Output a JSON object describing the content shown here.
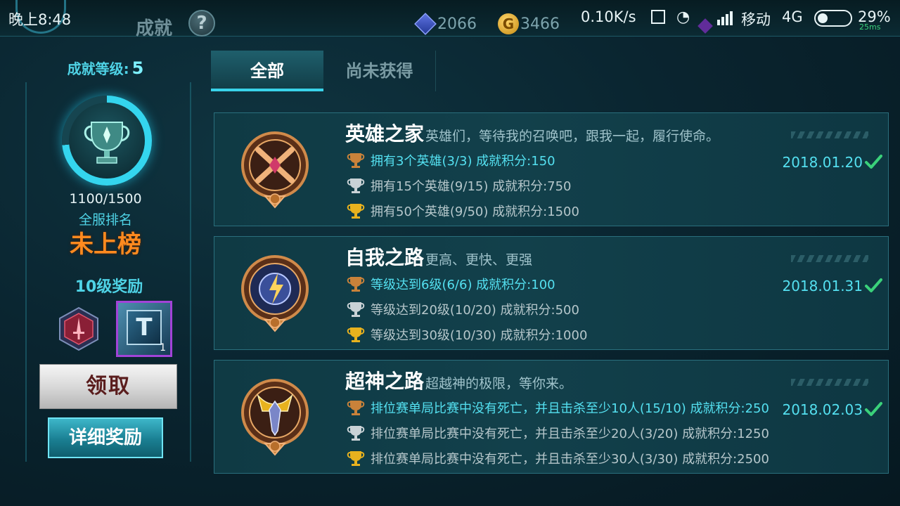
{
  "statusbar": {
    "time": "晚上8:48",
    "title": "成就",
    "help": "?",
    "diamonds": "2066",
    "gold_symbol": "G",
    "gold": "3466",
    "net_speed": "0.10K/s",
    "carrier": "移动",
    "network": "4G",
    "battery": "29%",
    "ping": "25ms"
  },
  "left": {
    "level_label": "成就等级:",
    "level_value": "5",
    "progress": "1100/1500",
    "progress_fraction": 0.7333,
    "rank_label": "全服排名",
    "rank_value": "未上榜",
    "reward_title": "10级奖励",
    "reward_card_glyph": "T",
    "reward_card_count": "1",
    "claim_label": "领取",
    "detail_label": "详细奖励"
  },
  "tabs": {
    "all": "全部",
    "not_obtained": "尚未获得"
  },
  "achievements": [
    {
      "title": "英雄之家",
      "desc": "英雄们，等待我的召唤吧，跟我一起，履行使命。",
      "date": "2018.01.20",
      "tiers": [
        {
          "text": "拥有3个英雄(3/3) 成就积分:150",
          "done": true
        },
        {
          "text": "拥有15个英雄(9/15) 成就积分:750",
          "done": false
        },
        {
          "text": "拥有50个英雄(9/50) 成就积分:1500",
          "done": false
        }
      ]
    },
    {
      "title": "自我之路",
      "desc": "更高、更快、更强",
      "date": "2018.01.31",
      "tiers": [
        {
          "text": "等级达到6级(6/6) 成就积分:100",
          "done": true
        },
        {
          "text": "等级达到20级(10/20) 成就积分:500",
          "done": false
        },
        {
          "text": "等级达到30级(10/30) 成就积分:1000",
          "done": false
        }
      ]
    },
    {
      "title": "超神之路",
      "desc": "超越神的极限，等你来。",
      "date": "2018.02.03",
      "tiers": [
        {
          "text": "排位赛单局比赛中没有死亡，并且击杀至少10人(15/10) 成就积分:250",
          "done": true
        },
        {
          "text": "排位赛单局比赛中没有死亡，并且击杀至少20人(3/20) 成就积分:1250",
          "done": false
        },
        {
          "text": "排位赛单局比赛中没有死亡，并且击杀至少30人(3/30) 成就积分:2500",
          "done": false
        }
      ]
    }
  ],
  "colors": {
    "accent": "#39d3ea",
    "rank": "#ff8a1f",
    "done_text": "#54e0f0",
    "bronze": "#c9823a",
    "silver": "#c9d2d6",
    "gold": "#e8b21e"
  },
  "icons": {
    "back": "back-ring-icon",
    "help": "question-mark-icon",
    "diamond": "diamond-icon",
    "gold": "gold-coin-icon",
    "trophy": "trophy-icon",
    "reward_badge": "sword-badge-icon",
    "reward_card": "card-frame-icon",
    "bronze_cup": "bronze-cup-icon",
    "silver_cup": "silver-cup-icon",
    "gold_cup": "gold-cup-icon",
    "check": "checkmark-icon"
  }
}
